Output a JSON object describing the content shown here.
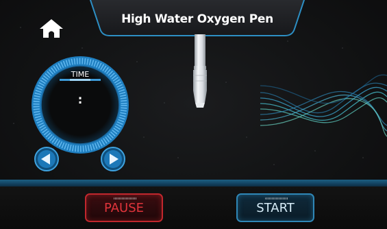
{
  "header": {
    "title": "High Water Oxygen Pen"
  },
  "home": {
    "icon": "home-icon"
  },
  "timer": {
    "label": "TIME",
    "value": ":"
  },
  "controls": {
    "decrease_icon": "left-arrow-icon",
    "increase_icon": "right-arrow-icon"
  },
  "actions": {
    "pause_label": "PAUSE",
    "start_label": "START"
  },
  "colors": {
    "accent": "#2f8fd0",
    "pause": "#e1343b",
    "start": "#2f87b7",
    "background": "#121314"
  }
}
